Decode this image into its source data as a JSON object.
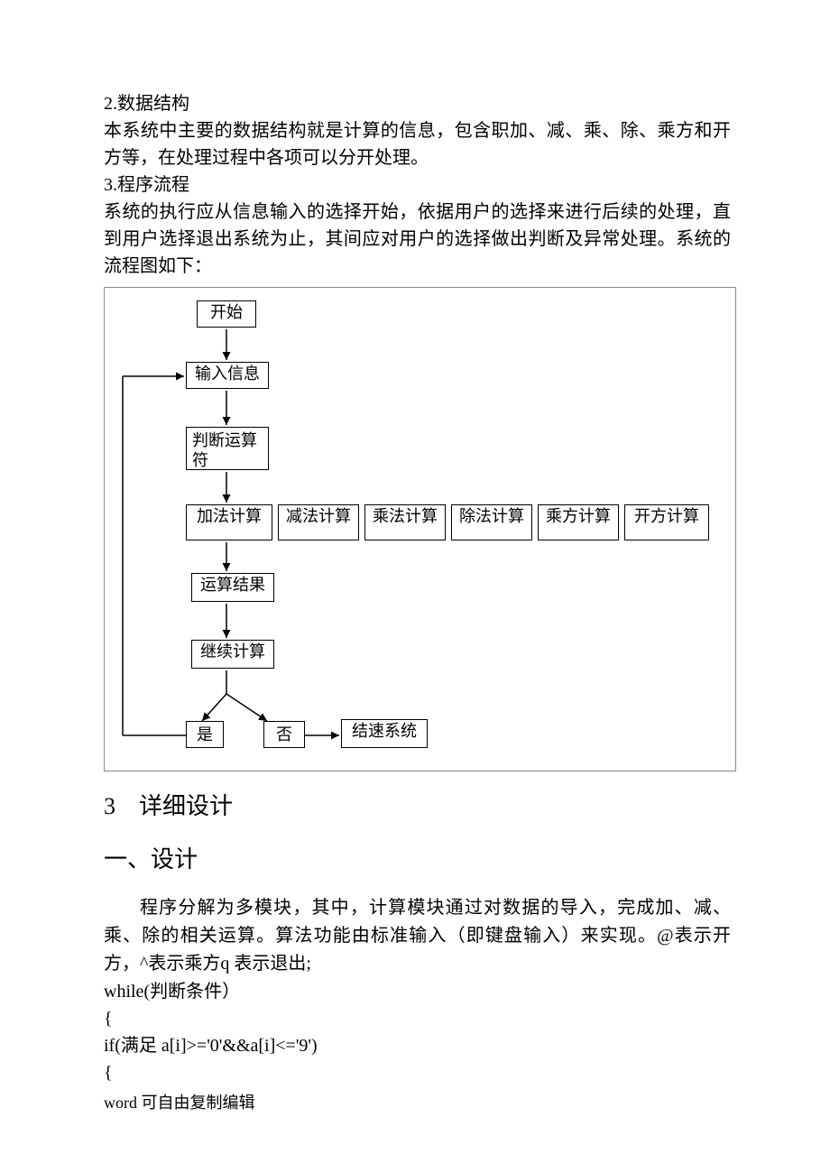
{
  "section2_title": "2.数据结构",
  "section2_body": "本系统中主要的数据结构就是计算的信息，包含职加、减、乘、除、乘方和开方等，在处理过程中各项可以分开处理。",
  "section3_title": "3.程序流程",
  "section3_body": "系统的执行应从信息输入的选择开始，依据用户的选择来进行后续的处理，直到用户选择退出系统为止，其间应对用户的选择做出判断及异常处理。系统的流程图如下：",
  "flowchart": {
    "start": "开始",
    "input": "输入信息",
    "judge": "判断运算符",
    "ops": {
      "add": "加法计算",
      "sub": "减法计算",
      "mul": "乘法计算",
      "div": "除法计算",
      "pow": "乘方计算",
      "sqrt": "开方计算"
    },
    "result": "运算结果",
    "continue": "继续计算",
    "yes": "是",
    "no": "否",
    "end": "结速系统"
  },
  "heading_a": "3　详细设计",
  "heading_b": "一、设计",
  "design_para": "程序分解为多模块，其中，计算模块通过对数据的导入，完成加、减、乘、除的相关运算。算法功能由标准输入（即键盘输入）来实现。@表示开方，^表示乘方q 表示退出;",
  "code": {
    "l1": "  while(判断条件）",
    "l2": " {",
    "l3": "   if(满足 a[i]>='0'&&a[i]<='9')",
    "l4": "   {"
  },
  "footer": "word 可自由复制编辑"
}
